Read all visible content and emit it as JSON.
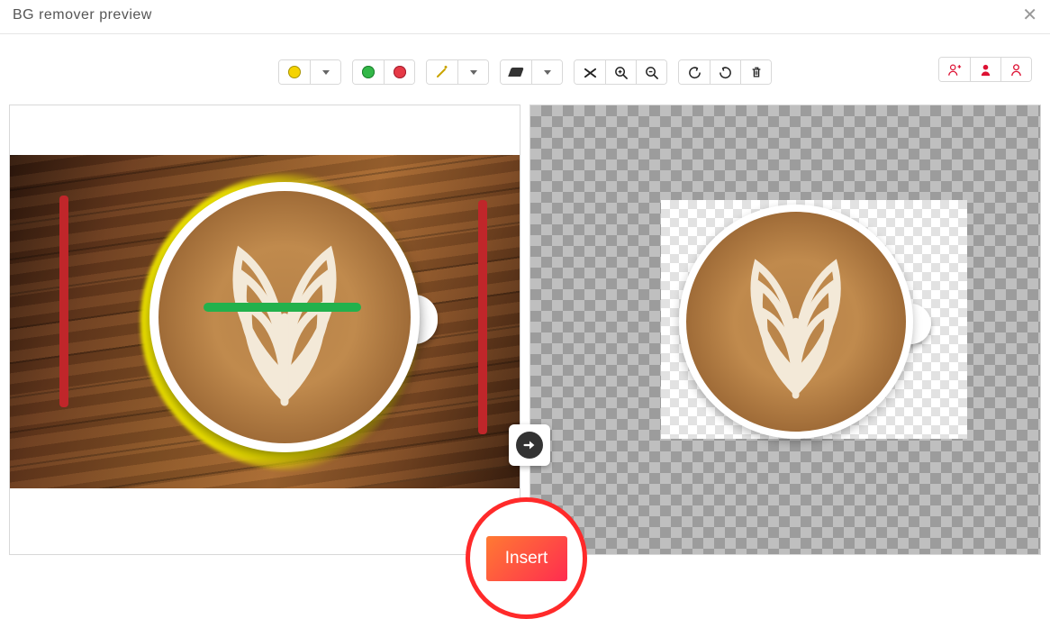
{
  "window": {
    "title": "BG remover preview"
  },
  "toolbar": {
    "marker": "yellow",
    "keep": "green",
    "remove": "red",
    "wand": "magic-wand",
    "eraser": "eraser",
    "shuffle": "shuffle",
    "zoom_in": "zoom-in",
    "zoom_out": "zoom-out",
    "undo": "undo",
    "redo": "redo",
    "trash": "trash"
  },
  "people_tools": {
    "add_person": "add-person",
    "person": "person",
    "single_person": "single-person"
  },
  "action": {
    "insert_label": "Insert"
  }
}
